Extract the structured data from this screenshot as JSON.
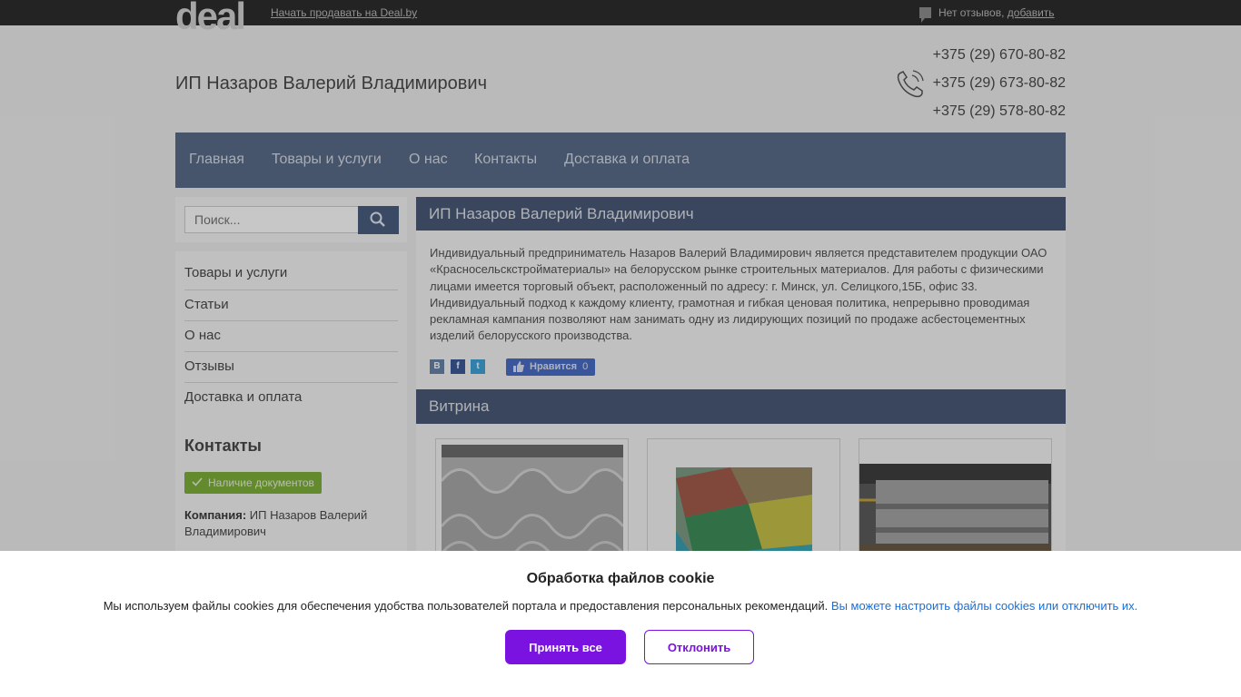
{
  "topbar": {
    "logo": "deal",
    "sell_link": "Начать продавать на Deal.by",
    "reviews_text": "Нет отзывов,",
    "reviews_add": "добавить"
  },
  "header": {
    "company": "ИП Назаров Валерий Владимирович",
    "phones": [
      "+375 (29) 670-80-82",
      "+375 (29) 673-80-82",
      "+375 (29) 578-80-82"
    ]
  },
  "nav": {
    "items": [
      "Главная",
      "Товары и услуги",
      "О нас",
      "Контакты",
      "Доставка и оплата"
    ]
  },
  "search": {
    "placeholder": "Поиск..."
  },
  "sidebar": {
    "items": [
      "Товары и услуги",
      "Статьи",
      "О нас",
      "Отзывы",
      "Доставка и оплата"
    ],
    "contacts_title": "Контакты",
    "docs_badge": "Наличие документов",
    "company_label": "Компания:",
    "company_value": "ИП Назаров Валерий Владимирович"
  },
  "main": {
    "title": "ИП Назаров Валерий Владимирович",
    "about": "Индивидуальный предприниматель Назаров Валерий Владимирович является представителем продукции ОАО «Красносельскстройматериалы» на белорусском рынке строительных материалов. Для работы с физическими лицами имеется торговый объект, расположенный по адресу: г. Минск, ул. Селицкого,15Б, офис 33. Индивидуальный подход к каждому клиенту, грамотная и гибкая ценовая политика, непрерывно проводимая рекламная кампания позволяют нам занимать одну из лидирующих позиций по продаже асбестоцементных изделий белорусского производства.",
    "share": [
      "В",
      "f",
      "t"
    ],
    "like_label": "Нравится",
    "like_count": "0",
    "vitrina_title": "Витрина"
  },
  "cookie": {
    "title": "Обработка файлов cookie",
    "text": "Мы используем файлы cookies для обеспечения удобства пользователей портала и предоставления персональных рекомендаций.",
    "link": "Вы можете настроить файлы cookies или отключить их.",
    "accept": "Принять все",
    "decline": "Отклонить"
  },
  "colors": {
    "nav": "#5a6c8b",
    "panel_header": "#4a5a78",
    "accept": "#7a12e0",
    "link": "#1a6fd6",
    "badge": "#7fb23a"
  }
}
